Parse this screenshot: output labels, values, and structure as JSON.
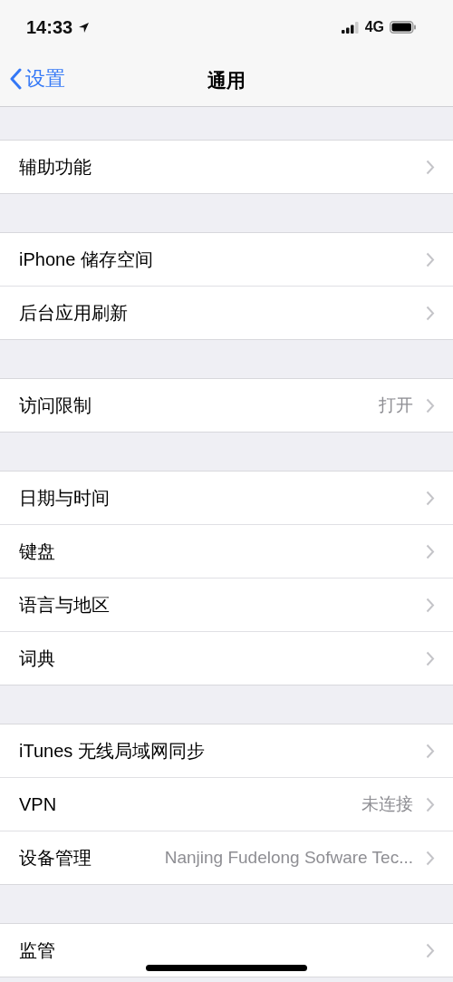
{
  "status_bar": {
    "time": "14:33",
    "network": "4G"
  },
  "nav": {
    "back": "设置",
    "title": "通用"
  },
  "groups": [
    {
      "rows": [
        {
          "label": "辅助功能"
        }
      ]
    },
    {
      "rows": [
        {
          "label": "iPhone 储存空间"
        },
        {
          "label": "后台应用刷新"
        }
      ]
    },
    {
      "rows": [
        {
          "label": "访问限制",
          "value": "打开"
        }
      ]
    },
    {
      "rows": [
        {
          "label": "日期与时间"
        },
        {
          "label": "键盘"
        },
        {
          "label": "语言与地区"
        },
        {
          "label": "词典"
        }
      ]
    },
    {
      "rows": [
        {
          "label": "iTunes 无线局域网同步"
        },
        {
          "label": "VPN",
          "value": "未连接"
        },
        {
          "label": "设备管理",
          "value": "Nanjing Fudelong Sofware Tec..."
        }
      ]
    },
    {
      "rows": [
        {
          "label": "监管"
        }
      ]
    }
  ]
}
